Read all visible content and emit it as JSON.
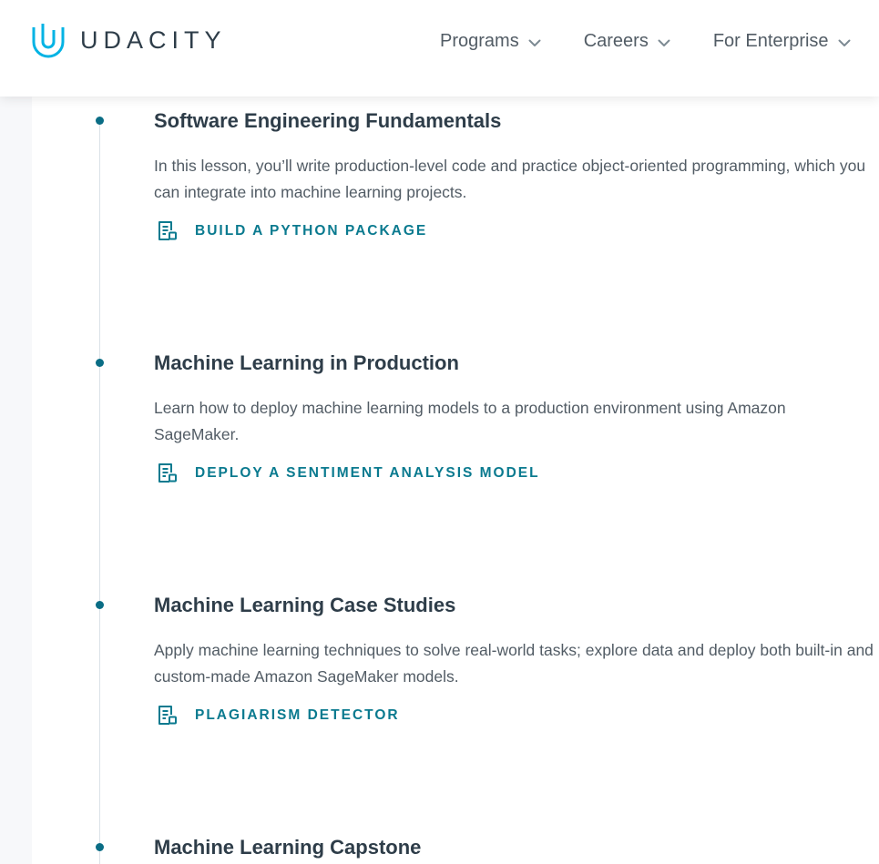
{
  "header": {
    "logo_text": "UDACITY",
    "nav": [
      {
        "label": "Programs"
      },
      {
        "label": "Careers"
      },
      {
        "label": "For Enterprise"
      }
    ]
  },
  "lessons": [
    {
      "title": "Software Engineering Fundamentals",
      "description": "In this lesson, you’ll write production-level code and practice object-oriented programming, which you can integrate into machine learning projects.",
      "project": "BUILD A PYTHON PACKAGE"
    },
    {
      "title": "Machine Learning in Production",
      "description": "Learn how to deploy machine learning models to a production environment using Amazon SageMaker.",
      "project": "DEPLOY A SENTIMENT ANALYSIS MODEL"
    },
    {
      "title": "Machine Learning Case Studies",
      "description": "Apply machine learning techniques to solve real-world tasks; explore data and deploy both built-in and custom-made Amazon SageMaker models.",
      "project": "PLAGIARISM DETECTOR"
    },
    {
      "title": "Machine Learning Capstone"
    }
  ],
  "icons": {
    "logo": "udacity-logo-icon",
    "nav_chevron": "chevron-down-icon",
    "project": "project-document-icon"
  },
  "colors": {
    "brand": "#02b3e4",
    "accent": "#0a7a8f",
    "heading": "#2e3d49",
    "body_text": "#525c65",
    "timeline": "#dbe2e8"
  }
}
